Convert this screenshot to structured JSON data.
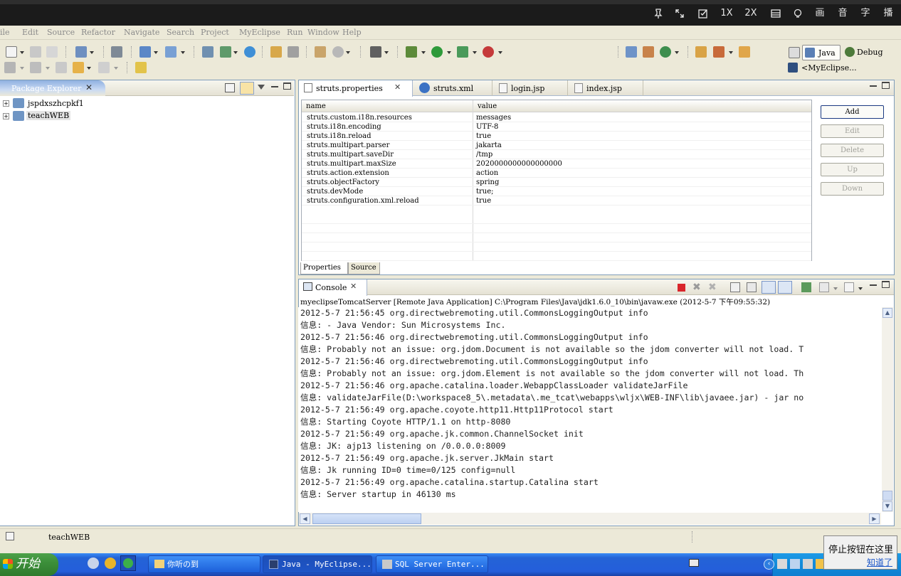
{
  "player_bar": {
    "controls": [
      {
        "label": "",
        "icon": "pin-icon"
      },
      {
        "label": "",
        "icon": "expand-icon"
      },
      {
        "label": "",
        "icon": "edit-check-icon"
      },
      {
        "label": "1X",
        "icon": ""
      },
      {
        "label": "2X",
        "icon": ""
      },
      {
        "label": "",
        "icon": "window-icon"
      },
      {
        "label": "",
        "icon": "bulb-icon"
      },
      {
        "label": "画",
        "icon": ""
      },
      {
        "label": "音",
        "icon": ""
      },
      {
        "label": "字",
        "icon": ""
      },
      {
        "label": "播",
        "icon": ""
      }
    ]
  },
  "menu": [
    "ile",
    "Edit",
    "Source",
    "Refactor",
    "Navigate",
    "Search",
    "Project",
    "MyEclipse",
    "Run",
    "Window",
    "Help"
  ],
  "perspectives": {
    "java": "Java",
    "debug": "Debug",
    "myeclipse": "<MyEclipse..."
  },
  "package_explorer": {
    "title": "Package Explorer",
    "projects": [
      "jspdxszhcpkf1",
      "teachWEB"
    ]
  },
  "editor_tabs": [
    {
      "label": "struts.properties",
      "active": true
    },
    {
      "label": "struts.xml",
      "active": false
    },
    {
      "label": "login.jsp",
      "active": false
    },
    {
      "label": "index.jsp",
      "active": false
    }
  ],
  "properties_table": {
    "headers": {
      "name": "name",
      "value": "value"
    },
    "rows": [
      {
        "name": "struts.custom.i18n.resources",
        "value": "messages"
      },
      {
        "name": "struts.i18n.encoding",
        "value": "UTF-8"
      },
      {
        "name": "struts.i18n.reload",
        "value": "true"
      },
      {
        "name": "struts.multipart.parser",
        "value": "jakarta"
      },
      {
        "name": "struts.multipart.saveDir",
        "value": "/tmp"
      },
      {
        "name": "struts.multipart.maxSize",
        "value": "2020000000000000000"
      },
      {
        "name": "struts.action.extension",
        "value": "action"
      },
      {
        "name": "struts.objectFactory",
        "value": "spring"
      },
      {
        "name": "struts.devMode",
        "value": "true;"
      },
      {
        "name": "struts.configuration.xml.reload",
        "value": "true"
      }
    ]
  },
  "property_buttons": {
    "add": "Add",
    "edit": "Edit",
    "delete": "Delete",
    "up": "Up",
    "down": "Down"
  },
  "editor_bottom_tabs": {
    "properties": "Properties",
    "source": "Source"
  },
  "console": {
    "title": "Console",
    "header": "myeclipseTomcatServer [Remote Java Application] C:\\Program Files\\Java\\jdk1.6.0_10\\bin\\javaw.exe (2012-5-7 下午09:55:32)",
    "lines": [
      "2012-5-7 21:56:45 org.directwebremoting.util.CommonsLoggingOutput info",
      "信息: - Java Vendor:    Sun Microsystems Inc.",
      "2012-5-7 21:56:46 org.directwebremoting.util.CommonsLoggingOutput info",
      "信息: Probably not an issue: org.jdom.Document is not available so the jdom converter will not load. T",
      "2012-5-7 21:56:46 org.directwebremoting.util.CommonsLoggingOutput info",
      "信息: Probably not an issue: org.jdom.Element is not available so the jdom converter will not load. Th",
      "2012-5-7 21:56:46 org.apache.catalina.loader.WebappClassLoader validateJarFile",
      "信息: validateJarFile(D:\\workspace8_5\\.metadata\\.me_tcat\\webapps\\wljx\\WEB-INF\\lib\\javaee.jar) - jar no",
      "2012-5-7 21:56:49 org.apache.coyote.http11.Http11Protocol start",
      "信息: Starting Coyote HTTP/1.1 on http-8080",
      "2012-5-7 21:56:49 org.apache.jk.common.ChannelSocket init",
      "信息: JK: ajp13 listening on /0.0.0.0:8009",
      "2012-5-7 21:56:49 org.apache.jk.server.JkMain start",
      "信息: Jk running ID=0 time=0/125  config=null",
      "2012-5-7 21:56:49 org.apache.catalina.startup.Catalina start",
      "信息: Server startup in 46130 ms"
    ]
  },
  "status_bar": {
    "selection": "teachWEB"
  },
  "taskbar": {
    "start": "开始",
    "tasks": [
      {
        "label": "你听の到",
        "icon": "folder-icon"
      },
      {
        "label": "Java - MyEclipse...",
        "icon": "myeclipse-icon"
      },
      {
        "label": "SQL Server Enter...",
        "icon": "sql-server-icon"
      }
    ]
  },
  "balloon": {
    "text": "停止按钮在这里",
    "link": "知道了"
  },
  "colors": {
    "taskbar": "#245edb",
    "start_green": "#3c8f3a",
    "tab_active": "#9bb8e4",
    "panel_border": "#7f9db9"
  }
}
